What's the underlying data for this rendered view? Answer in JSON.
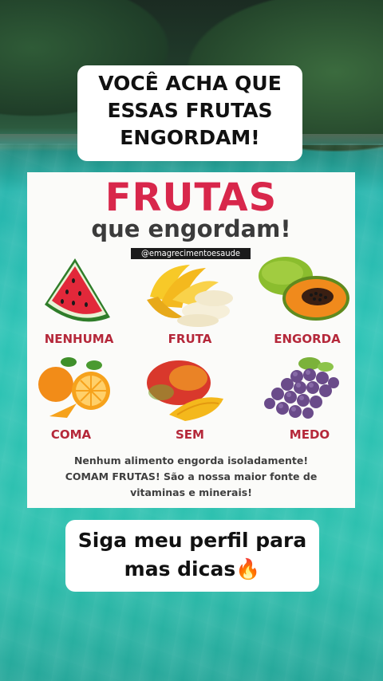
{
  "caption_top": {
    "line1": "VOCÊ ACHA QUE",
    "line2": "ESSAS FRUTAS",
    "line3": "ENGORDAM!"
  },
  "card": {
    "title": "FRUTAS",
    "subtitle": "que engordam!",
    "handle": "@emagrecimentoesaude",
    "words": [
      "NENHUMA",
      "FRUTA",
      "ENGORDA",
      "COMA",
      "SEM",
      "MEDO"
    ],
    "footer": {
      "line1": "Nenhum alimento engorda isoladamente!",
      "line2": "COMAM FRUTAS! São a nossa maior fonte de",
      "line3": "vitaminas e minerais!"
    },
    "fruit_icons": [
      "watermelon-icon",
      "banana-icon",
      "papaya-icon",
      "orange-icon",
      "mango-icon",
      "grapes-icon"
    ]
  },
  "caption_bottom": {
    "line1": "Siga meu perfil para",
    "line2": "mas dicas🔥"
  },
  "colors": {
    "title_red": "#d8274b",
    "word_red": "#b5283a",
    "water": "#2ec4b6"
  }
}
